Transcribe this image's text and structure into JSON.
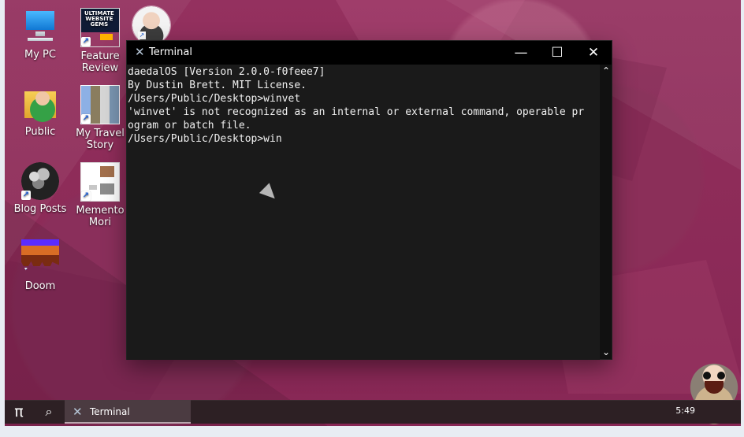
{
  "desktop": {
    "icons": [
      {
        "label_1": "My PC",
        "label_2": "",
        "icon": "computer-icon"
      },
      {
        "label_1": "Feature",
        "label_2": "Review",
        "icon": "feature-review-icon"
      },
      {
        "label_1": "Public",
        "label_2": "",
        "icon": "folder-user-icon"
      },
      {
        "label_1": "My Travel",
        "label_2": "Story",
        "icon": "travel-story-icon"
      },
      {
        "label_1": "Blog Posts",
        "label_2": "",
        "icon": "brain-icon"
      },
      {
        "label_1": "Memento",
        "label_2": "Mori",
        "icon": "document-icon"
      },
      {
        "label_1": "Doom",
        "label_2": "",
        "icon": "doom-icon"
      }
    ]
  },
  "terminal": {
    "title": "Terminal",
    "lines": [
      "daedalOS [Version 2.0.0-f0feee7]",
      "By Dustin Brett. MIT License.",
      "",
      "/Users/Public/Desktop>winvet",
      "'winvet' is not recognized as an internal or external command, operable pr",
      "ogram or batch file.",
      "",
      "/Users/Public/Desktop>win"
    ],
    "controls": {
      "minimize": "—",
      "maximize": "☐",
      "close": "✕",
      "scroll_up": "⌃",
      "scroll_down": "⌄"
    }
  },
  "taskbar": {
    "start_icon": "π",
    "search_icon": "⌕",
    "task_label": "Terminal",
    "time": "5:49"
  }
}
